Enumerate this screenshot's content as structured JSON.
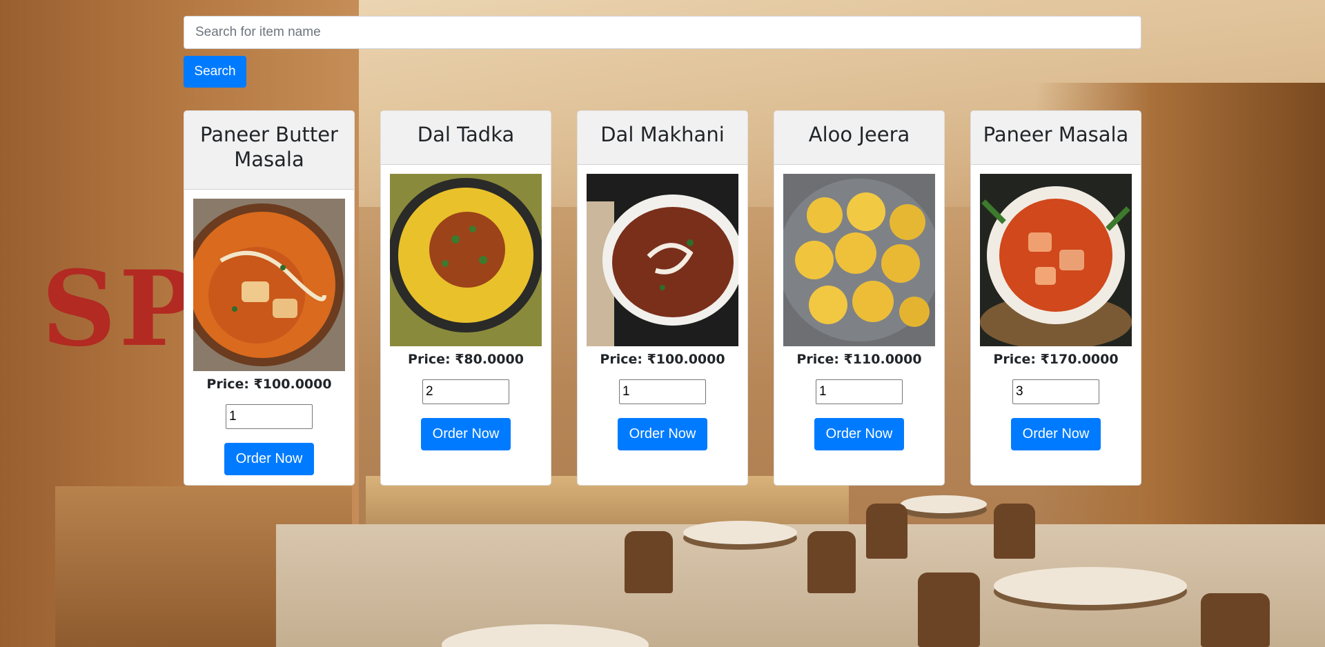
{
  "search": {
    "placeholder": "Search for item name",
    "button_label": "Search"
  },
  "theme": {
    "primary": "#007bff",
    "card_header_bg": "#f1f1f1"
  },
  "items": [
    {
      "name": "Paneer Butter Masala",
      "price": "Price: ₹100.0000",
      "quantity": "1",
      "order_label": "Order Now",
      "image": "paneer-butter-masala-photo"
    },
    {
      "name": "Dal Tadka",
      "price": "Price: ₹80.0000",
      "quantity": "2",
      "order_label": "Order Now",
      "image": "dal-tadka-photo"
    },
    {
      "name": "Dal Makhani",
      "price": "Price: ₹100.0000",
      "quantity": "1",
      "order_label": "Order Now",
      "image": "dal-makhani-photo"
    },
    {
      "name": "Aloo Jeera",
      "price": "Price: ₹110.0000",
      "quantity": "1",
      "order_label": "Order Now",
      "image": "aloo-jeera-photo"
    },
    {
      "name": "Paneer Masala",
      "price": "Price: ₹170.0000",
      "quantity": "3",
      "order_label": "Order Now",
      "image": "paneer-masala-photo"
    }
  ]
}
